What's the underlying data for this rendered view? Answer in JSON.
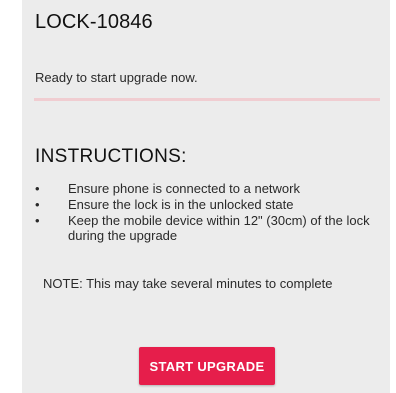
{
  "header": {
    "lock_id": "LOCK-10846"
  },
  "status": {
    "message": "Ready to start upgrade now.",
    "progress": 0
  },
  "instructions": {
    "heading": "INSTRUCTIONS:",
    "bullet_glyph": "•",
    "items": [
      "Ensure phone is connected to a network",
      "Ensure the lock is in the unlocked state",
      "Keep the mobile device within 12\" (30cm) of the lock during the upgrade"
    ]
  },
  "note": {
    "text": "NOTE: This may take several minutes to complete"
  },
  "actions": {
    "start_label": "START UPGRADE"
  },
  "colors": {
    "accent": "#e61e4b",
    "progress_track": "#f0cdd1",
    "panel_background": "#ececec"
  }
}
